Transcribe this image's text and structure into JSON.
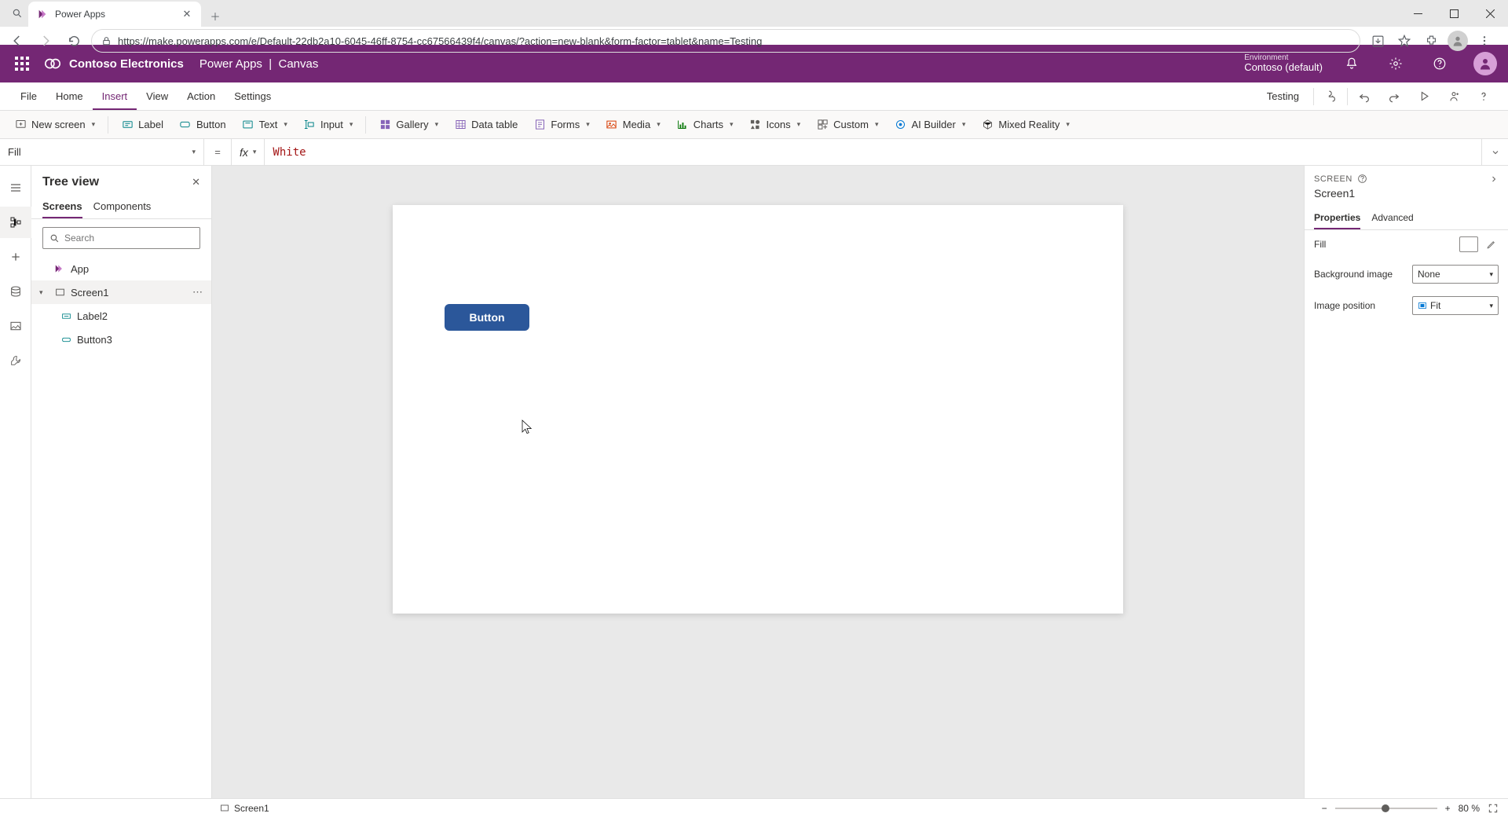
{
  "browser": {
    "tab_title": "Power Apps",
    "url": "https://make.powerapps.com/e/Default-22db2a10-6045-46ff-8754-cc67566439f4/canvas/?action=new-blank&form-factor=tablet&name=Testing"
  },
  "suite": {
    "org": "Contoso Electronics",
    "app": "Power Apps",
    "mode": "Canvas",
    "env_label": "Environment",
    "env_name": "Contoso (default)"
  },
  "ribbon": {
    "tabs": {
      "file": "File",
      "home": "Home",
      "insert": "Insert",
      "view": "View",
      "action": "Action",
      "settings": "Settings"
    },
    "app_name": "Testing"
  },
  "insert": {
    "new_screen": "New screen",
    "label": "Label",
    "button": "Button",
    "text": "Text",
    "input": "Input",
    "gallery": "Gallery",
    "data_table": "Data table",
    "forms": "Forms",
    "media": "Media",
    "charts": "Charts",
    "icons": "Icons",
    "custom": "Custom",
    "ai_builder": "AI Builder",
    "mixed_reality": "Mixed Reality"
  },
  "formula": {
    "property": "Fill",
    "value": "White",
    "fx": "fx"
  },
  "tree": {
    "title": "Tree view",
    "tab_screens": "Screens",
    "tab_components": "Components",
    "search_placeholder": "Search",
    "app_node": "App",
    "screen1": "Screen1",
    "label2": "Label2",
    "button3": "Button3"
  },
  "canvas": {
    "button_text": "Button"
  },
  "props": {
    "kind": "SCREEN",
    "name": "Screen1",
    "tab_properties": "Properties",
    "tab_advanced": "Advanced",
    "fill_label": "Fill",
    "bg_label": "Background image",
    "bg_value": "None",
    "imgpos_label": "Image position",
    "imgpos_value": "Fit"
  },
  "status": {
    "screen": "Screen1",
    "zoom": "80",
    "pct": "%"
  }
}
